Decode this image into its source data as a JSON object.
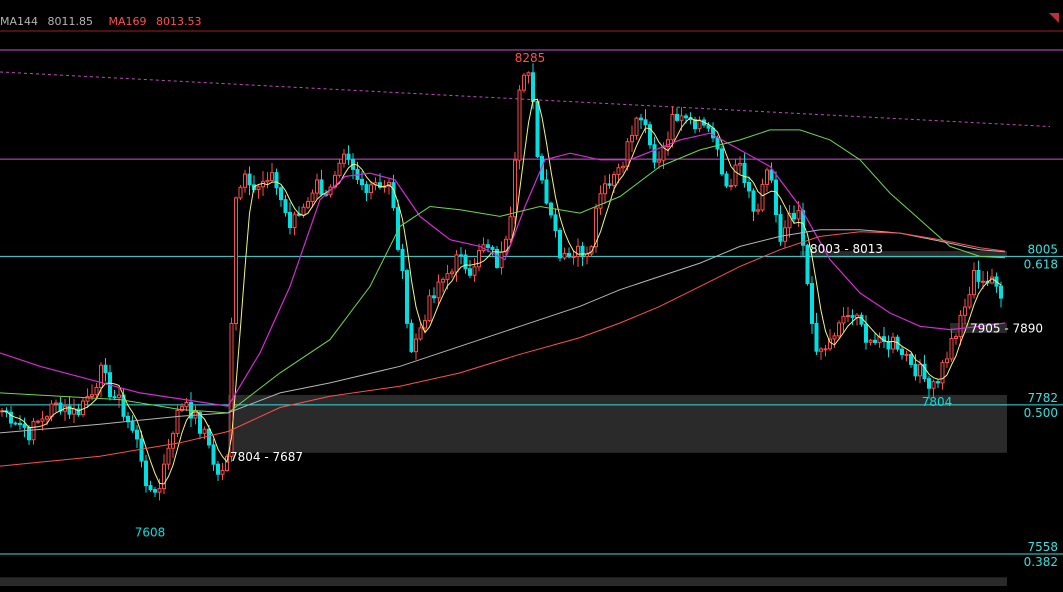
{
  "chart_data": {
    "type": "line",
    "ylim": [
      7510,
      8345
    ],
    "x": [
      0,
      1005
    ],
    "legend": [
      {
        "label": "MA144",
        "value": "8011.85",
        "color": "#b5b5b5"
      },
      {
        "label": "MA169",
        "value": "8013.53",
        "color": "#ff5050"
      }
    ],
    "colors": {
      "up": "#ff4a4a",
      "down": "#00e0e0",
      "ma_short": "#f5f57a",
      "ma_mid": "#d62ad6",
      "ma_60": "#6fd84a",
      "ma144": "#b5b5b5",
      "ma169": "#ff5050",
      "hline_cyan": "#38e0e0",
      "hline_magenta": "#d050d0",
      "trend": "#c24ac2",
      "zone": "#2a2a2a"
    },
    "horizontal_levels": [
      {
        "value": 8151,
        "color": "magenta"
      },
      {
        "value": 8005,
        "color": "cyan",
        "label": "8005",
        "sub": "0.618"
      },
      {
        "value": 7782,
        "color": "cyan",
        "label": "7782",
        "sub": "0.500"
      },
      {
        "value": 7558,
        "color": "cyan",
        "label": "7558",
        "sub": "0.382"
      }
    ],
    "top_line": 8315,
    "trend_line": {
      "from": [
        0,
        8282
      ],
      "to": [
        1050,
        8200
      ]
    },
    "zones": [
      {
        "x0": 228,
        "x1": 1007,
        "low": 7710,
        "high": 7797
      },
      {
        "x0": 800,
        "x1": 1007,
        "low": 8003,
        "high": 8013
      },
      {
        "x0": 950,
        "x1": 1007,
        "low": 7890,
        "high": 7905
      },
      {
        "x0": 0,
        "x1": 1007,
        "low": 7510,
        "high": 7523
      }
    ],
    "annotations": [
      {
        "text": "8285",
        "x": 530,
        "y": 8285,
        "color": "#ff5050",
        "anchor": "middle",
        "pos": "above"
      },
      {
        "text": "7608",
        "x": 150,
        "y": 7608,
        "color": "#00e0e0",
        "anchor": "middle",
        "pos": "below"
      },
      {
        "text": "7804",
        "x": 937,
        "y": 7804,
        "color": "#00e0e0",
        "anchor": "middle",
        "pos": "below"
      },
      {
        "text": "7804 - 7687",
        "x": 228,
        "y": 7704,
        "color": "#ffffff",
        "anchor": "start",
        "pos": "right"
      },
      {
        "text": "8003 - 8013",
        "x": 808,
        "y": 8016,
        "color": "#ffffff",
        "anchor": "start",
        "pos": "right"
      },
      {
        "text": "7905 - 7890",
        "x": 968,
        "y": 7897,
        "color": "#ffffff",
        "anchor": "start",
        "pos": "right"
      }
    ],
    "waypoints": [
      [
        0,
        7775
      ],
      [
        15,
        7762
      ],
      [
        30,
        7740
      ],
      [
        45,
        7768
      ],
      [
        60,
        7785
      ],
      [
        75,
        7770
      ],
      [
        90,
        7800
      ],
      [
        100,
        7832
      ],
      [
        110,
        7805
      ],
      [
        125,
        7770
      ],
      [
        140,
        7715
      ],
      [
        150,
        7640
      ],
      [
        160,
        7665
      ],
      [
        172,
        7745
      ],
      [
        185,
        7795
      ],
      [
        195,
        7760
      ],
      [
        210,
        7720
      ],
      [
        218,
        7675
      ],
      [
        228,
        7700
      ],
      [
        235,
        8100
      ],
      [
        245,
        8130
      ],
      [
        260,
        8110
      ],
      [
        275,
        8120
      ],
      [
        290,
        8050
      ],
      [
        300,
        8070
      ],
      [
        315,
        8115
      ],
      [
        330,
        8100
      ],
      [
        345,
        8150
      ],
      [
        360,
        8110
      ],
      [
        375,
        8120
      ],
      [
        390,
        8110
      ],
      [
        400,
        8000
      ],
      [
        412,
        7860
      ],
      [
        425,
        7920
      ],
      [
        440,
        7960
      ],
      [
        455,
        8000
      ],
      [
        470,
        7990
      ],
      [
        485,
        8020
      ],
      [
        500,
        7990
      ],
      [
        512,
        8090
      ],
      [
        520,
        8280
      ],
      [
        530,
        8270
      ],
      [
        540,
        8130
      ],
      [
        550,
        8080
      ],
      [
        560,
        8015
      ],
      [
        575,
        8010
      ],
      [
        590,
        8020
      ],
      [
        600,
        8110
      ],
      [
        615,
        8130
      ],
      [
        625,
        8160
      ],
      [
        640,
        8220
      ],
      [
        655,
        8140
      ],
      [
        670,
        8200
      ],
      [
        680,
        8230
      ],
      [
        695,
        8210
      ],
      [
        710,
        8200
      ],
      [
        725,
        8110
      ],
      [
        740,
        8140
      ],
      [
        755,
        8060
      ],
      [
        770,
        8140
      ],
      [
        780,
        8020
      ],
      [
        790,
        8060
      ],
      [
        800,
        8060
      ],
      [
        810,
        7920
      ],
      [
        820,
        7850
      ],
      [
        835,
        7890
      ],
      [
        850,
        7920
      ],
      [
        865,
        7890
      ],
      [
        880,
        7870
      ],
      [
        895,
        7880
      ],
      [
        910,
        7850
      ],
      [
        925,
        7820
      ],
      [
        937,
        7820
      ],
      [
        950,
        7870
      ],
      [
        962,
        7910
      ],
      [
        975,
        7980
      ],
      [
        990,
        7965
      ],
      [
        1005,
        7950
      ]
    ],
    "ma_mid_points": [
      [
        0,
        7860
      ],
      [
        40,
        7840
      ],
      [
        90,
        7820
      ],
      [
        140,
        7800
      ],
      [
        185,
        7790
      ],
      [
        228,
        7780
      ],
      [
        260,
        7860
      ],
      [
        290,
        7960
      ],
      [
        320,
        8090
      ],
      [
        345,
        8125
      ],
      [
        370,
        8130
      ],
      [
        395,
        8120
      ],
      [
        420,
        8065
      ],
      [
        450,
        8030
      ],
      [
        480,
        8020
      ],
      [
        505,
        8000
      ],
      [
        525,
        8080
      ],
      [
        545,
        8150
      ],
      [
        570,
        8160
      ],
      [
        600,
        8150
      ],
      [
        630,
        8150
      ],
      [
        655,
        8165
      ],
      [
        680,
        8180
      ],
      [
        710,
        8190
      ],
      [
        740,
        8165
      ],
      [
        770,
        8140
      ],
      [
        800,
        8080
      ],
      [
        830,
        8000
      ],
      [
        860,
        7950
      ],
      [
        890,
        7920
      ],
      [
        920,
        7900
      ],
      [
        950,
        7895
      ],
      [
        980,
        7900
      ],
      [
        1005,
        7905
      ]
    ],
    "ma60_points": [
      [
        0,
        7800
      ],
      [
        60,
        7795
      ],
      [
        120,
        7790
      ],
      [
        180,
        7775
      ],
      [
        228,
        7770
      ],
      [
        280,
        7830
      ],
      [
        330,
        7880
      ],
      [
        370,
        7960
      ],
      [
        400,
        8050
      ],
      [
        430,
        8080
      ],
      [
        460,
        8075
      ],
      [
        500,
        8065
      ],
      [
        540,
        8080
      ],
      [
        580,
        8070
      ],
      [
        620,
        8095
      ],
      [
        660,
        8140
      ],
      [
        700,
        8165
      ],
      [
        740,
        8180
      ],
      [
        770,
        8195
      ],
      [
        800,
        8195
      ],
      [
        830,
        8180
      ],
      [
        860,
        8150
      ],
      [
        890,
        8100
      ],
      [
        920,
        8060
      ],
      [
        950,
        8020
      ],
      [
        980,
        8005
      ],
      [
        1005,
        8003
      ]
    ],
    "ma144_points": [
      [
        0,
        7740
      ],
      [
        100,
        7753
      ],
      [
        180,
        7765
      ],
      [
        228,
        7770
      ],
      [
        280,
        7800
      ],
      [
        330,
        7815
      ],
      [
        400,
        7840
      ],
      [
        460,
        7870
      ],
      [
        520,
        7900
      ],
      [
        580,
        7930
      ],
      [
        620,
        7955
      ],
      [
        660,
        7975
      ],
      [
        700,
        7995
      ],
      [
        740,
        8020
      ],
      [
        780,
        8035
      ],
      [
        820,
        8045
      ],
      [
        860,
        8045
      ],
      [
        900,
        8040
      ],
      [
        940,
        8028
      ],
      [
        980,
        8015
      ],
      [
        1005,
        8012
      ]
    ],
    "ma169_points": [
      [
        0,
        7690
      ],
      [
        100,
        7705
      ],
      [
        180,
        7725
      ],
      [
        228,
        7742
      ],
      [
        280,
        7778
      ],
      [
        330,
        7795
      ],
      [
        400,
        7810
      ],
      [
        460,
        7830
      ],
      [
        520,
        7858
      ],
      [
        580,
        7883
      ],
      [
        620,
        7905
      ],
      [
        660,
        7930
      ],
      [
        700,
        7960
      ],
      [
        740,
        7990
      ],
      [
        780,
        8015
      ],
      [
        820,
        8035
      ],
      [
        860,
        8042
      ],
      [
        900,
        8040
      ],
      [
        940,
        8030
      ],
      [
        980,
        8018
      ],
      [
        1005,
        8013
      ]
    ]
  }
}
